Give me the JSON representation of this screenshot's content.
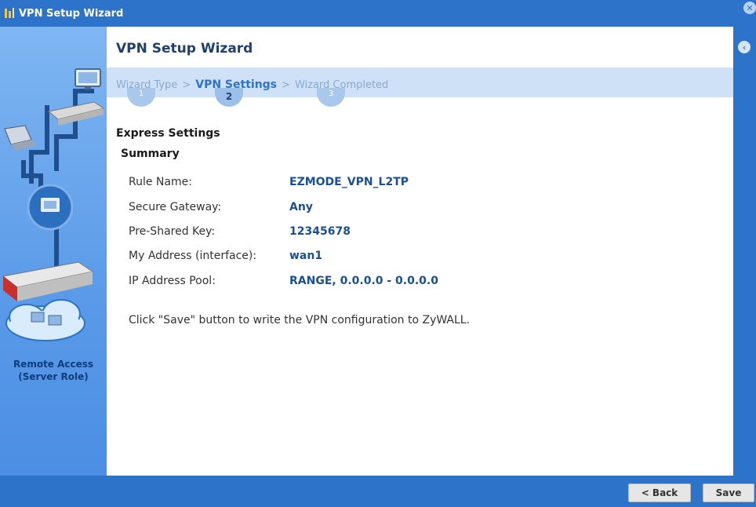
{
  "window": {
    "title": "VPN Setup Wizard",
    "close_glyph": "✕",
    "icon": "wizard-icon"
  },
  "sidebar": {
    "role_line1": "Remote Access",
    "role_line2": "(Server Role)",
    "illustration": "network-topology-icon"
  },
  "main": {
    "heading": "VPN Setup Wizard",
    "collapse_glyph": "‹",
    "steps": [
      {
        "label": "Wizard Type",
        "number": "1"
      },
      {
        "label": "VPN Settings",
        "number": "2",
        "active": true
      },
      {
        "label": "Wizard Completed",
        "number": "3"
      }
    ],
    "step_separator": ">",
    "section_title": "Express Settings",
    "summary_title": "Summary",
    "summary": [
      {
        "label": "Rule Name:",
        "value": "EZMODE_VPN_L2TP"
      },
      {
        "label": "Secure Gateway:",
        "value": "Any"
      },
      {
        "label": "Pre-Shared Key:",
        "value": "12345678"
      },
      {
        "label": "My Address (interface):",
        "value": "wan1"
      },
      {
        "label": "IP Address Pool:",
        "value": "RANGE, 0.0.0.0 - 0.0.0.0"
      }
    ],
    "note": "Click \"Save\" button to write the VPN configuration to ZyWALL."
  },
  "footer": {
    "back_label": "< Back",
    "save_label": "Save"
  },
  "colors": {
    "accent": "#2d73c9",
    "value_text": "#1a4f96",
    "step_band": "#cfe1f6"
  }
}
